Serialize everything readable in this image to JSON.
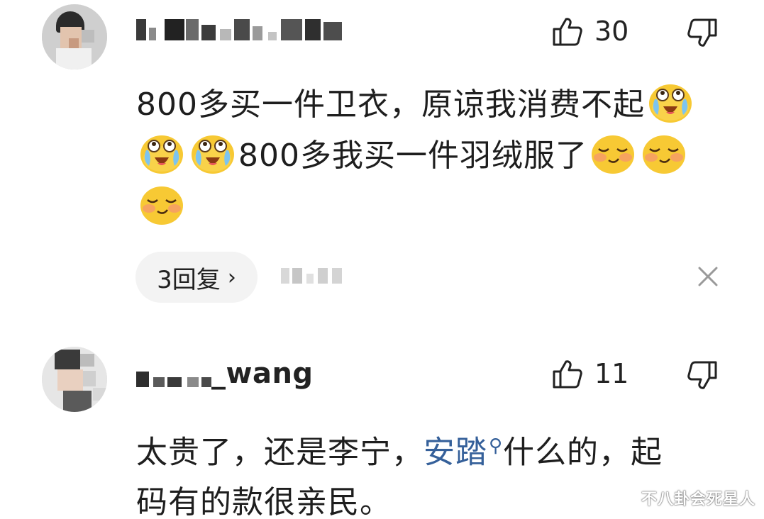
{
  "comments": [
    {
      "username": "",
      "likes": "30",
      "text_line1": "800多买一件卫衣，原谅我消费不起",
      "text_line2": "800多我买一件羽绒服了",
      "emoji": [
        "crying-laugh-emoji",
        "crying-laugh-emoji",
        "crying-laugh-emoji",
        "shy-smile-emoji",
        "shy-smile-emoji",
        "shy-smile-emoji"
      ],
      "replies_label": "3回复",
      "replies_chevron": "›"
    },
    {
      "username_suffix": "_wang",
      "likes": "11",
      "text_line1_before": "太贵了，还是李宁，",
      "text_link": "安踏",
      "text_line1_after": "什么的，起",
      "text_line2": "码有的款很亲民。"
    }
  ],
  "watermark": "不八卦会死星人",
  "colors": {
    "link": "#35609a",
    "pill_bg": "#f3f3f3",
    "text": "#1e1e1e",
    "emoji_yellow": "#f7c934"
  },
  "icons": [
    "thumbs-up-icon",
    "thumbs-down-icon",
    "close-icon",
    "search-icon",
    "chevron-right-icon"
  ]
}
